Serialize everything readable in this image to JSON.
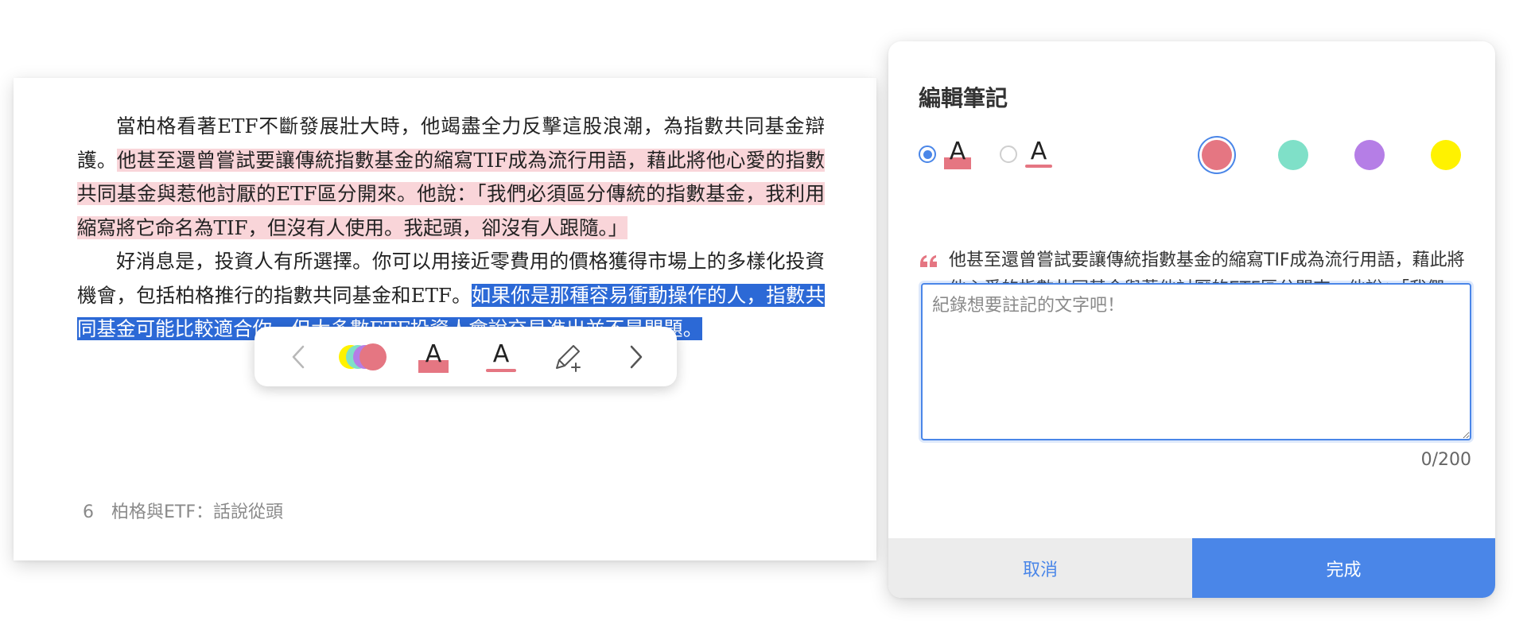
{
  "book": {
    "para1_start": "當柏格看著ETF不斷發展壯大時，他竭盡全力反擊這股浪潮，為指數共同基金辯護。",
    "para1_highlight": "他甚至還曾嘗試要讓傳統指數基金的縮寫TIF成為流行用語，藉此將他心愛的指數共同基金與惹他討厭的ETF區分開來。他說：「我們必須區分傳統的指數基金，我利用縮寫將它命名為TIF，但沒有人使用。我起頭，卻沒有人跟隨。」",
    "para2_start": "好消息是，投資人有所選擇。你可以用接近零費用的價格獲得市場上的多樣化投資機會，包括柏格推行的指數共同基金和ETF。",
    "para2_selected": "如果你是那種容易衝動操作的人，指數共同基金可能比較適合你，但大多數ETF投資人會說交易進出並不是問題。",
    "page_number": "6",
    "chapter_title": "柏格與ETF：話說從頭"
  },
  "toolbar": {
    "prev_icon": "chevron-left-icon",
    "color_icon": "color-stack-icon",
    "highlight_letter": "A",
    "underline_letter": "A",
    "note_icon": "pen-plus-icon",
    "next_icon": "chevron-right-icon"
  },
  "panel": {
    "title": "編輯筆記",
    "style_highlight_letter": "A",
    "style_underline_letter": "A",
    "selected_style": "highlight",
    "colors": [
      "#e57682",
      "#7fe0c8",
      "#b57ee6",
      "#fff200"
    ],
    "selected_color": "#e57682",
    "quote": "他甚至還曾嘗試要讓傳統指數基金的縮寫TIF成為流行用語，藉此將他心愛的指數共同基金與惹他討厭的ETF區分開來。他說：「我們必須區分傳統的指數基金，我利用縮寫將它命名為TIF，但沒有人使用。我起頭，卻沒有人跟隨。」",
    "input_value": "",
    "input_placeholder": "紀錄想要註記的文字吧！",
    "counter": "0/200",
    "cancel_label": "取消",
    "done_label": "完成"
  },
  "colors": {
    "accent": "#4a86e8",
    "highlight_pink": "#f9d5d9",
    "selection_blue": "#2c69d6"
  }
}
